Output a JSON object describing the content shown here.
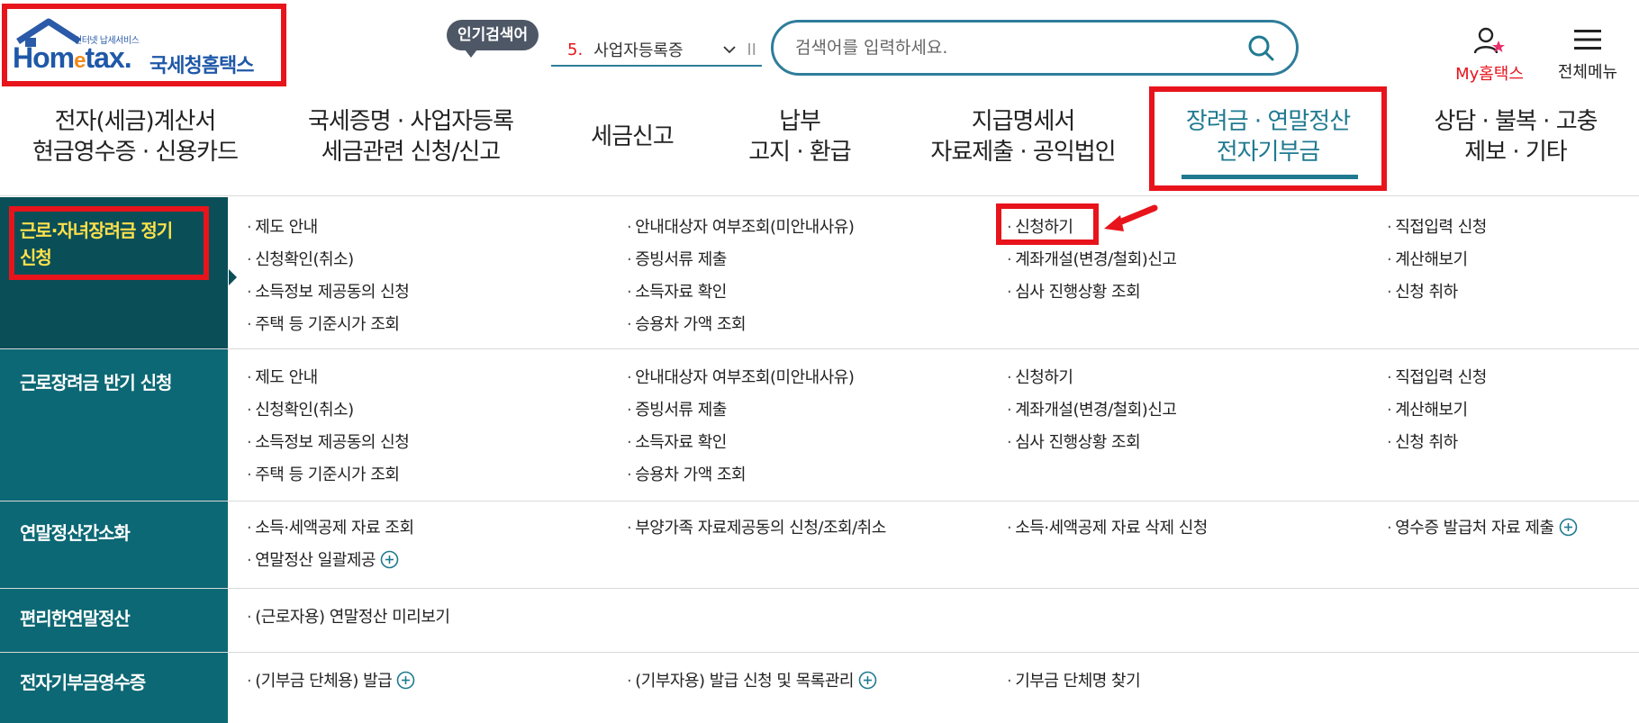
{
  "brand": {
    "small_label": "인터넷 납세서비스",
    "name_en_pre": "Hom",
    "name_en_e": "e",
    "name_en_post": "tax.",
    "name_ko": "국세청홈택스"
  },
  "popular": {
    "badge": "인기검색어",
    "rank": "5.",
    "term": "사업자등록증",
    "pause": "II"
  },
  "search": {
    "placeholder": "검색어를 입력하세요."
  },
  "utility": {
    "my_hometax": "My홈택스",
    "all_menu": "전체메뉴"
  },
  "gnb": [
    {
      "line1": "전자(세금)계산서",
      "line2": "현금영수증 · 신용카드"
    },
    {
      "line1": "국세증명 · 사업자등록",
      "line2": "세금관련 신청/신고"
    },
    {
      "line1": "세금신고",
      "line2": ""
    },
    {
      "line1": "납부",
      "line2": "고지 · 환급"
    },
    {
      "line1": "지급명세서",
      "line2": "자료제출 · 공익법인"
    },
    {
      "line1": "장려금 · 연말정산",
      "line2": "전자기부금"
    },
    {
      "line1": "상담 · 불복 · 고충",
      "line2": "제보 · 기타"
    }
  ],
  "menu": [
    {
      "title_l1": "근로·자녀장려금 정기",
      "title_l2": "신청",
      "cols": [
        [
          "제도 안내",
          "신청확인(취소)",
          "소득정보 제공동의 신청",
          "주택 등 기준시가 조회"
        ],
        [
          "안내대상자 여부조회(미안내사유)",
          "증빙서류 제출",
          "소득자료 확인",
          "승용차 가액 조회"
        ],
        [
          "신청하기",
          "계좌개설(변경/철회)신고",
          "심사 진행상황 조회"
        ],
        [
          "직접입력 신청",
          "계산해보기",
          "신청 취하"
        ]
      ]
    },
    {
      "title_l1": "근로장려금 반기 신청",
      "title_l2": "",
      "cols": [
        [
          "제도 안내",
          "신청확인(취소)",
          "소득정보 제공동의 신청",
          "주택 등 기준시가 조회"
        ],
        [
          "안내대상자 여부조회(미안내사유)",
          "증빙서류 제출",
          "소득자료 확인",
          "승용차 가액 조회"
        ],
        [
          "신청하기",
          "계좌개설(변경/철회)신고",
          "심사 진행상황 조회"
        ],
        [
          "직접입력 신청",
          "계산해보기",
          "신청 취하"
        ]
      ]
    },
    {
      "title_l1": "연말정산간소화",
      "title_l2": "",
      "cols": [
        [
          "소득·세액공제 자료 조회",
          "연말정산 일괄제공"
        ],
        [
          "부양가족 자료제공동의 신청/조회/취소"
        ],
        [
          "소득·세액공제 자료 삭제 신청"
        ],
        [
          "영수증 발급처 자료 제출"
        ]
      ]
    },
    {
      "title_l1": "편리한연말정산",
      "title_l2": "",
      "cols": [
        [
          "(근로자용) 연말정산 미리보기"
        ]
      ]
    },
    {
      "title_l1": "전자기부금영수증",
      "title_l2": "",
      "cols": [
        [
          "(기부금 단체용) 발급"
        ],
        [
          "(기부자용) 발급 신청 및 목록관리"
        ],
        [
          "기부금 단체명 찾기"
        ]
      ]
    }
  ]
}
